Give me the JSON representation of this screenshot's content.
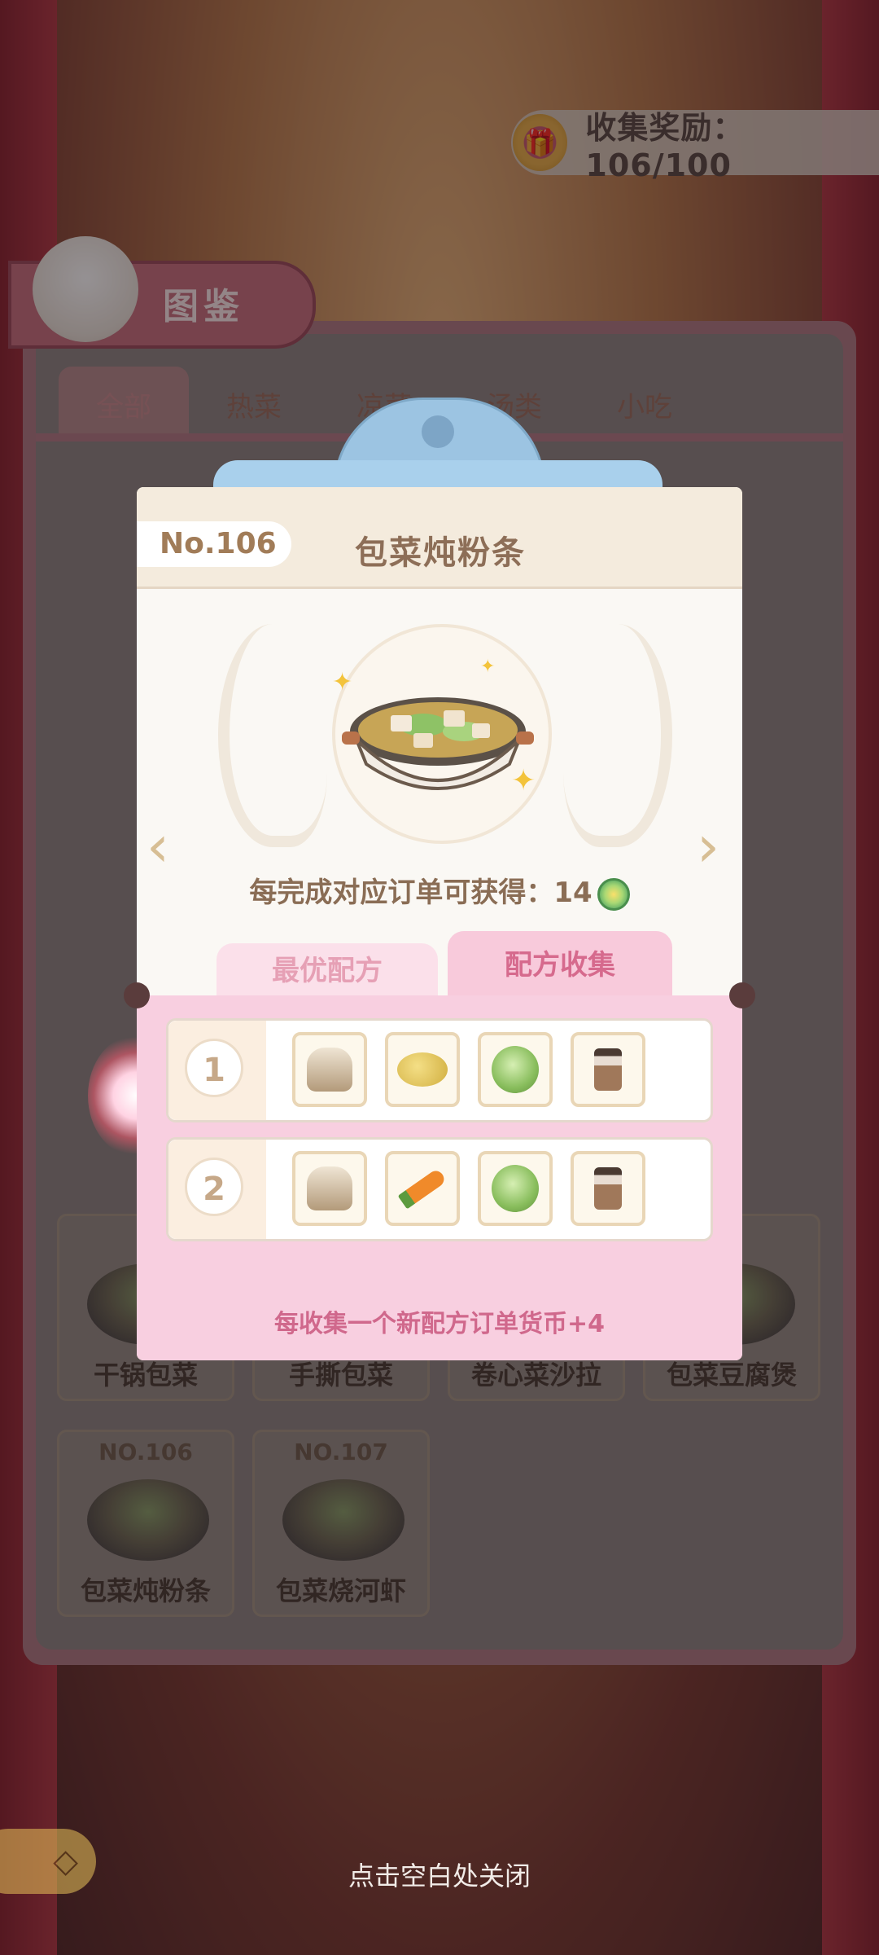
{
  "header": {
    "reward_label": "收集奖励：106/100",
    "reward_icon": "gift-icon"
  },
  "album": {
    "title": "图鉴",
    "tabs": [
      "全部",
      "热菜",
      "凉菜",
      "汤类",
      "小吃"
    ],
    "cards": [
      {
        "num": "NO.106",
        "name": "包菜炖粉条"
      },
      {
        "num": "NO.107",
        "name": "包菜烧河虾"
      },
      {
        "num": "",
        "name": "干锅包菜"
      },
      {
        "num": "",
        "name": "手撕包菜"
      },
      {
        "num": "",
        "name": "卷心菜沙拉"
      },
      {
        "num": "",
        "name": "包菜豆腐煲"
      }
    ]
  },
  "modal": {
    "number": "No.106",
    "title": "包菜炖粉条",
    "reward_text": "每完成对应订单可获得：14",
    "tabs": {
      "best": "最优配方",
      "collect": "配方收集"
    },
    "recipes": [
      {
        "index": "1",
        "ingredients": [
          "flour",
          "potato",
          "cabbage",
          "seasoning-jar"
        ]
      },
      {
        "index": "2",
        "ingredients": [
          "flour",
          "carrot",
          "cabbage",
          "seasoning-jar"
        ]
      }
    ],
    "bonus_text": "每收集一个新配方订单货币+4"
  },
  "footer": {
    "close_hint": "点击空白处关闭"
  },
  "colors": {
    "accent_pink": "#d66a8d",
    "clip_blue": "#9cc4e2",
    "text_brown": "#8d6e57"
  }
}
